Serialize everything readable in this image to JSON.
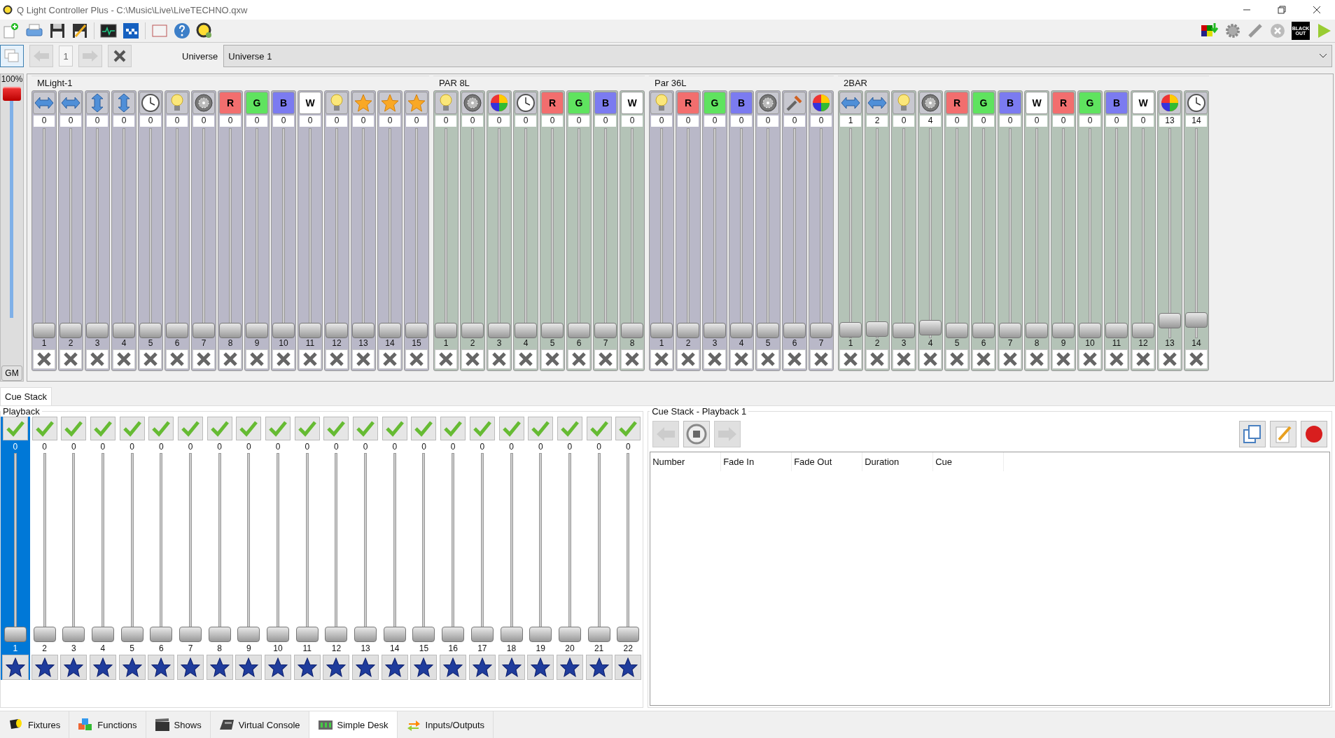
{
  "window": {
    "title": "Q Light Controller Plus - C:\\Music\\Live\\LiveTECHNO.qxw"
  },
  "toolbar": {
    "blackout": "BLACK OUT"
  },
  "universe_bar": {
    "page": "1",
    "label": "Universe",
    "value": "Universe 1"
  },
  "grand_master": {
    "value": "100%",
    "label": "GM",
    "level": 1
  },
  "fixtures": [
    {
      "name": "MLight-1",
      "color": "#b9b8c8",
      "channels": [
        {
          "kind": "pan",
          "value": "0",
          "number": "1",
          "level": 0
        },
        {
          "kind": "pan",
          "value": "0",
          "number": "2",
          "level": 0
        },
        {
          "kind": "tilt",
          "value": "0",
          "number": "3",
          "level": 0
        },
        {
          "kind": "tilt",
          "value": "0",
          "number": "4",
          "level": 0
        },
        {
          "kind": "speed",
          "value": "0",
          "number": "5",
          "level": 0
        },
        {
          "kind": "intensity",
          "value": "0",
          "number": "6",
          "level": 0
        },
        {
          "kind": "shutter",
          "value": "0",
          "number": "7",
          "level": 0
        },
        {
          "kind": "color",
          "label": "R",
          "color": "#f26e6e",
          "value": "0",
          "number": "8",
          "level": 0
        },
        {
          "kind": "color",
          "label": "G",
          "color": "#5fe35f",
          "value": "0",
          "number": "9",
          "level": 0
        },
        {
          "kind": "color",
          "label": "B",
          "color": "#7b7bf0",
          "value": "0",
          "number": "10",
          "level": 0
        },
        {
          "kind": "color",
          "label": "W",
          "color": "#ffffff",
          "value": "0",
          "number": "11",
          "level": 0
        },
        {
          "kind": "intensity",
          "value": "0",
          "number": "12",
          "level": 0
        },
        {
          "kind": "effect",
          "value": "0",
          "number": "13",
          "level": 0
        },
        {
          "kind": "effect",
          "value": "0",
          "number": "14",
          "level": 0
        },
        {
          "kind": "effect",
          "value": "0",
          "number": "15",
          "level": 0
        }
      ]
    },
    {
      "name": "PAR 8L",
      "color": "#b4c3b7",
      "channels": [
        {
          "kind": "intensity",
          "value": "0",
          "number": "1",
          "level": 0
        },
        {
          "kind": "shutter",
          "value": "0",
          "number": "2",
          "level": 0
        },
        {
          "kind": "colorwheel",
          "value": "0",
          "number": "3",
          "level": 0
        },
        {
          "kind": "speed",
          "value": "0",
          "number": "4",
          "level": 0
        },
        {
          "kind": "color",
          "label": "R",
          "color": "#f26e6e",
          "value": "0",
          "number": "5",
          "level": 0
        },
        {
          "kind": "color",
          "label": "G",
          "color": "#5fe35f",
          "value": "0",
          "number": "6",
          "level": 0
        },
        {
          "kind": "color",
          "label": "B",
          "color": "#7b7bf0",
          "value": "0",
          "number": "7",
          "level": 0
        },
        {
          "kind": "color",
          "label": "W",
          "color": "#ffffff",
          "value": "0",
          "number": "8",
          "level": 0
        }
      ]
    },
    {
      "name": "Par 36L",
      "color": "#b9b8c8",
      "channels": [
        {
          "kind": "intensity",
          "value": "0",
          "number": "1",
          "level": 0
        },
        {
          "kind": "color",
          "label": "R",
          "color": "#f26e6e",
          "value": "0",
          "number": "2",
          "level": 0
        },
        {
          "kind": "color",
          "label": "G",
          "color": "#5fe35f",
          "value": "0",
          "number": "3",
          "level": 0
        },
        {
          "kind": "color",
          "label": "B",
          "color": "#7b7bf0",
          "value": "0",
          "number": "4",
          "level": 0
        },
        {
          "kind": "shutter",
          "value": "0",
          "number": "5",
          "level": 0
        },
        {
          "kind": "tools",
          "value": "0",
          "number": "6",
          "level": 0
        },
        {
          "kind": "colorwheel",
          "value": "0",
          "number": "7",
          "level": 0
        }
      ]
    },
    {
      "name": "2BAR",
      "color": "#b4c3b7",
      "channels": [
        {
          "kind": "pan",
          "value": "1",
          "number": "1",
          "level": 0.004
        },
        {
          "kind": "pan",
          "value": "2",
          "number": "2",
          "level": 0.008
        },
        {
          "kind": "intensity",
          "value": "0",
          "number": "3",
          "level": 0
        },
        {
          "kind": "shutter",
          "value": "4",
          "number": "4",
          "level": 0.016
        },
        {
          "kind": "color",
          "label": "R",
          "color": "#f26e6e",
          "value": "0",
          "number": "5",
          "level": 0
        },
        {
          "kind": "color",
          "label": "G",
          "color": "#5fe35f",
          "value": "0",
          "number": "6",
          "level": 0
        },
        {
          "kind": "color",
          "label": "B",
          "color": "#7b7bf0",
          "value": "0",
          "number": "7",
          "level": 0
        },
        {
          "kind": "color",
          "label": "W",
          "color": "#ffffff",
          "value": "0",
          "number": "8",
          "level": 0
        },
        {
          "kind": "color",
          "label": "R",
          "color": "#f26e6e",
          "value": "0",
          "number": "9",
          "level": 0
        },
        {
          "kind": "color",
          "label": "G",
          "color": "#5fe35f",
          "value": "0",
          "number": "10",
          "level": 0
        },
        {
          "kind": "color",
          "label": "B",
          "color": "#7b7bf0",
          "value": "0",
          "number": "11",
          "level": 0
        },
        {
          "kind": "color",
          "label": "W",
          "color": "#ffffff",
          "value": "0",
          "number": "12",
          "level": 0
        },
        {
          "kind": "colorwheel",
          "value": "13",
          "number": "13",
          "level": 0.051
        },
        {
          "kind": "speed",
          "value": "14",
          "number": "14",
          "level": 0.055
        }
      ]
    }
  ],
  "cue_stack_tab": {
    "label": "Cue Stack",
    "selected": true
  },
  "playback": {
    "title": "Playback",
    "items": [
      {
        "value": "0",
        "number": "1",
        "level": 0,
        "selected": true
      },
      {
        "value": "0",
        "number": "2",
        "level": 0,
        "selected": false
      },
      {
        "value": "0",
        "number": "3",
        "level": 0,
        "selected": false
      },
      {
        "value": "0",
        "number": "4",
        "level": 0,
        "selected": false
      },
      {
        "value": "0",
        "number": "5",
        "level": 0,
        "selected": false
      },
      {
        "value": "0",
        "number": "6",
        "level": 0,
        "selected": false
      },
      {
        "value": "0",
        "number": "7",
        "level": 0,
        "selected": false
      },
      {
        "value": "0",
        "number": "8",
        "level": 0,
        "selected": false
      },
      {
        "value": "0",
        "number": "9",
        "level": 0,
        "selected": false
      },
      {
        "value": "0",
        "number": "10",
        "level": 0,
        "selected": false
      },
      {
        "value": "0",
        "number": "11",
        "level": 0,
        "selected": false
      },
      {
        "value": "0",
        "number": "12",
        "level": 0,
        "selected": false
      },
      {
        "value": "0",
        "number": "13",
        "level": 0,
        "selected": false
      },
      {
        "value": "0",
        "number": "14",
        "level": 0,
        "selected": false
      },
      {
        "value": "0",
        "number": "15",
        "level": 0,
        "selected": false
      },
      {
        "value": "0",
        "number": "16",
        "level": 0,
        "selected": false
      },
      {
        "value": "0",
        "number": "17",
        "level": 0,
        "selected": false
      },
      {
        "value": "0",
        "number": "18",
        "level": 0,
        "selected": false
      },
      {
        "value": "0",
        "number": "19",
        "level": 0,
        "selected": false
      },
      {
        "value": "0",
        "number": "20",
        "level": 0,
        "selected": false
      },
      {
        "value": "0",
        "number": "21",
        "level": 0,
        "selected": false
      },
      {
        "value": "0",
        "number": "22",
        "level": 0,
        "selected": false
      }
    ]
  },
  "cue_stack": {
    "title": "Cue Stack - Playback 1",
    "columns": [
      "Number",
      "Fade In",
      "Fade Out",
      "Duration",
      "Cue"
    ]
  },
  "bottom_tabs": [
    {
      "label": "Fixtures",
      "kind": "fixtures",
      "selected": false
    },
    {
      "label": "Functions",
      "kind": "functions",
      "selected": false
    },
    {
      "label": "Shows",
      "kind": "shows",
      "selected": false
    },
    {
      "label": "Virtual Console",
      "kind": "console",
      "selected": false
    },
    {
      "label": "Simple Desk",
      "kind": "desk",
      "selected": true
    },
    {
      "label": "Inputs/Outputs",
      "kind": "io",
      "selected": false
    }
  ]
}
